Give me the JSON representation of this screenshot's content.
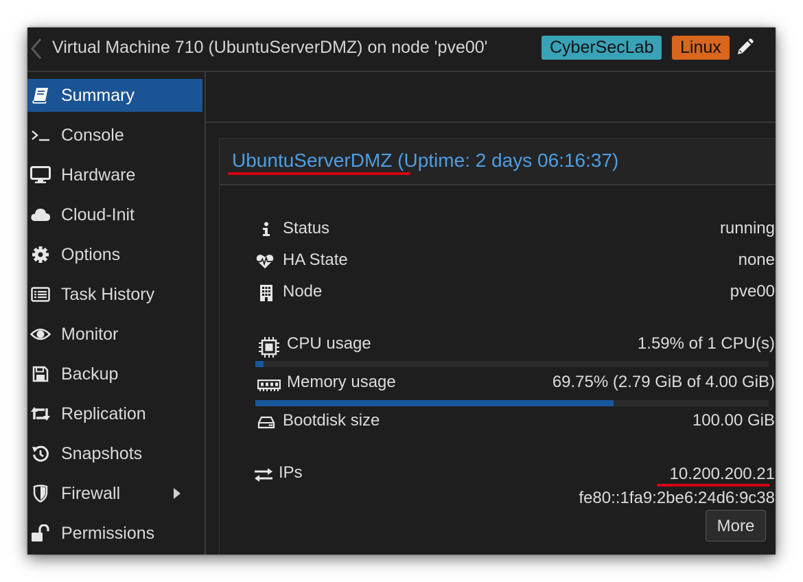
{
  "header": {
    "title": "Virtual Machine 710 (UbuntuServerDMZ) on node 'pve00'",
    "tags": [
      {
        "label": "CyberSecLab",
        "color": "#39a2b7"
      },
      {
        "label": "Linux",
        "color": "#d8661e"
      }
    ],
    "edit_icon": "pencil-icon",
    "back_icon": "chevron-left-icon"
  },
  "sidebar": {
    "active_color": "#1b5494",
    "items": [
      {
        "label": "Summary",
        "icon": "book-icon",
        "active": true
      },
      {
        "label": "Console",
        "icon": "terminal-icon"
      },
      {
        "label": "Hardware",
        "icon": "monitor-icon"
      },
      {
        "label": "Cloud-Init",
        "icon": "cloud-icon"
      },
      {
        "label": "Options",
        "icon": "gear-icon"
      },
      {
        "label": "Task History",
        "icon": "list-icon"
      },
      {
        "label": "Monitor",
        "icon": "eye-icon"
      },
      {
        "label": "Backup",
        "icon": "floppy-icon"
      },
      {
        "label": "Replication",
        "icon": "retweet-icon"
      },
      {
        "label": "Snapshots",
        "icon": "history-icon"
      },
      {
        "label": "Firewall",
        "icon": "shield-icon",
        "expandable": true
      },
      {
        "label": "Permissions",
        "icon": "unlock-icon"
      }
    ]
  },
  "summary": {
    "vm_name": "UbuntuServerDMZ",
    "uptime_text": " (Uptime: 2 days 06:16:37)",
    "status": {
      "label": "Status",
      "value": "running",
      "icon": "info-icon"
    },
    "ha_state": {
      "label": "HA State",
      "value": "none",
      "icon": "heartbeat-icon"
    },
    "node": {
      "label": "Node",
      "value": "pve00",
      "icon": "building-icon"
    },
    "cpu": {
      "label": "CPU usage",
      "value": "1.59% of 1 CPU(s)",
      "fraction": 0.0159,
      "icon": "cpu-icon"
    },
    "memory": {
      "label": "Memory usage",
      "value": "69.75% (2.79 GiB of 4.00 GiB)",
      "fraction": 0.6975,
      "icon": "memory-icon"
    },
    "bootdisk": {
      "label": "Bootdisk size",
      "value": "100.00 GiB",
      "icon": "hdd-icon"
    },
    "ips": {
      "label": "IPs",
      "ipv4": "10.200.200.21",
      "ipv6": "fe80::1fa9:2be6:24d6:9c38",
      "icon": "exchange-icon"
    },
    "more_label": "More",
    "link_color": "#4e9ee5",
    "highlight_color": "#d40012"
  }
}
